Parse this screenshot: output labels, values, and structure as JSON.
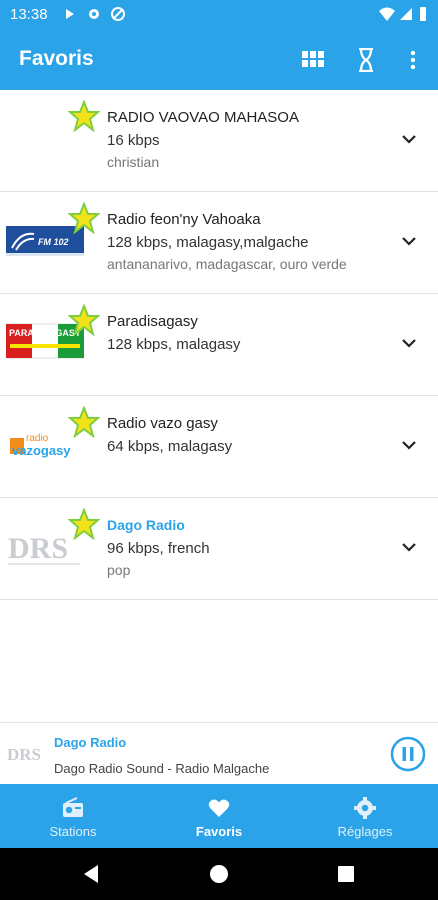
{
  "status_bar": {
    "time": "13:38"
  },
  "app_bar": {
    "title": "Favoris"
  },
  "stations": [
    {
      "name": "RADIO VAOVAO MAHASOA",
      "line2": "16 kbps",
      "line3": "christian",
      "active": false
    },
    {
      "name": "Radio feon'ny Vahoaka",
      "line2": "128 kbps, malagasy,malgache",
      "line3": "antananarivo, madagascar, ouro verde",
      "active": false,
      "logo_text": "FM 102"
    },
    {
      "name": "Paradisagasy",
      "line2": "128 kbps, malagasy",
      "line3": "",
      "active": false,
      "logo_text": "PARADISAGASY"
    },
    {
      "name": "Radio vazo gasy",
      "line2": "64 kbps, malagasy",
      "line3": "",
      "active": false,
      "logo_text_top": "radio",
      "logo_text_main": "vazogasy"
    },
    {
      "name": "Dago Radio",
      "line2": "96 kbps, french",
      "line3": "pop",
      "active": true,
      "logo_text": "DRS"
    }
  ],
  "player": {
    "station": "Dago Radio",
    "subtitle": "Dago Radio Sound - Radio Malgache",
    "logo_text": "DRS"
  },
  "bottom_nav": [
    {
      "label": "Stations",
      "icon": "radio-icon",
      "active": false
    },
    {
      "label": "Favoris",
      "icon": "heart-icon",
      "active": true
    },
    {
      "label": "Réglages",
      "icon": "gear-icon",
      "active": false
    }
  ],
  "colors": {
    "accent": "#2aa3e8",
    "star": "#f2e21a",
    "star_outline": "#7ecf3f"
  }
}
